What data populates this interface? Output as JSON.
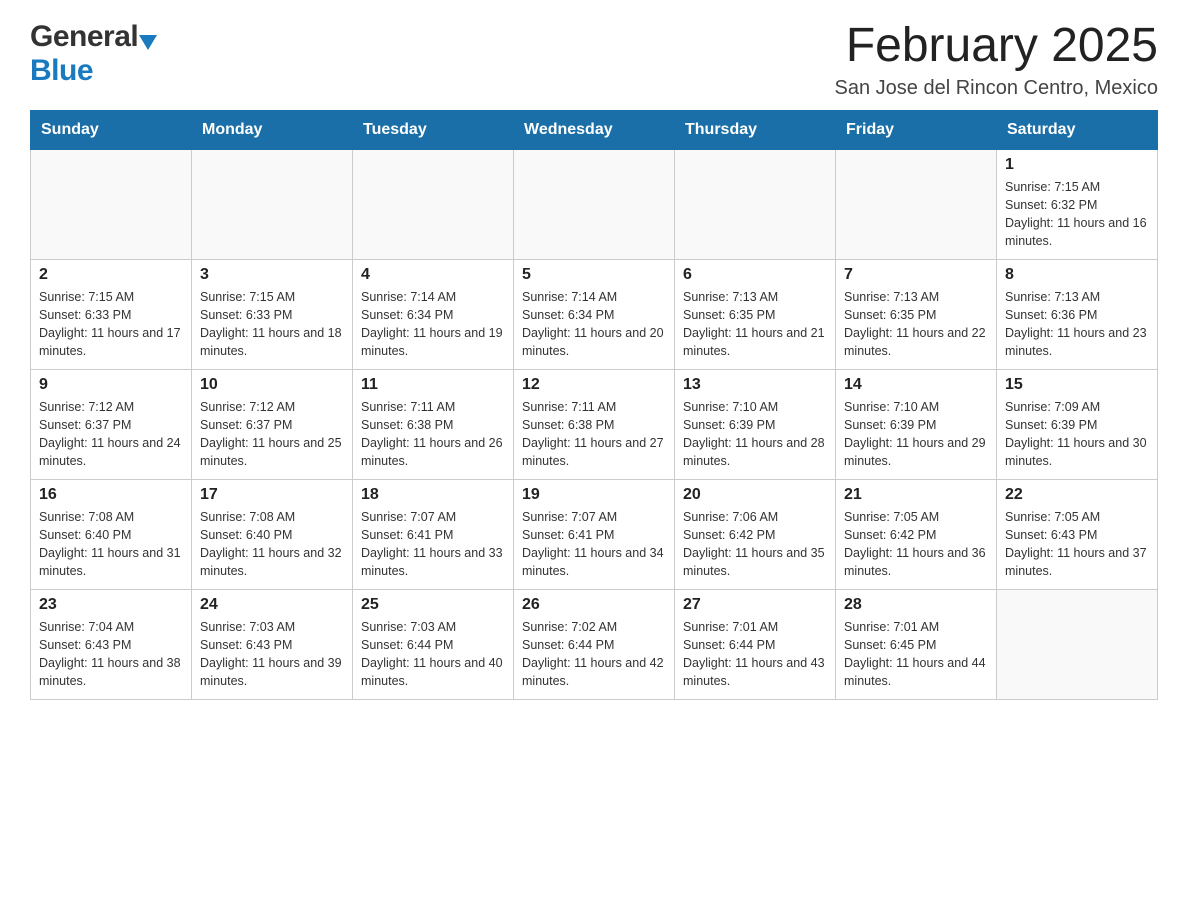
{
  "header": {
    "logo_general": "General",
    "logo_blue": "Blue",
    "title": "February 2025",
    "subtitle": "San Jose del Rincon Centro, Mexico"
  },
  "calendar": {
    "days_of_week": [
      "Sunday",
      "Monday",
      "Tuesday",
      "Wednesday",
      "Thursday",
      "Friday",
      "Saturday"
    ],
    "weeks": [
      [
        {
          "day": "",
          "info": ""
        },
        {
          "day": "",
          "info": ""
        },
        {
          "day": "",
          "info": ""
        },
        {
          "day": "",
          "info": ""
        },
        {
          "day": "",
          "info": ""
        },
        {
          "day": "",
          "info": ""
        },
        {
          "day": "1",
          "info": "Sunrise: 7:15 AM\nSunset: 6:32 PM\nDaylight: 11 hours and 16 minutes."
        }
      ],
      [
        {
          "day": "2",
          "info": "Sunrise: 7:15 AM\nSunset: 6:33 PM\nDaylight: 11 hours and 17 minutes."
        },
        {
          "day": "3",
          "info": "Sunrise: 7:15 AM\nSunset: 6:33 PM\nDaylight: 11 hours and 18 minutes."
        },
        {
          "day": "4",
          "info": "Sunrise: 7:14 AM\nSunset: 6:34 PM\nDaylight: 11 hours and 19 minutes."
        },
        {
          "day": "5",
          "info": "Sunrise: 7:14 AM\nSunset: 6:34 PM\nDaylight: 11 hours and 20 minutes."
        },
        {
          "day": "6",
          "info": "Sunrise: 7:13 AM\nSunset: 6:35 PM\nDaylight: 11 hours and 21 minutes."
        },
        {
          "day": "7",
          "info": "Sunrise: 7:13 AM\nSunset: 6:35 PM\nDaylight: 11 hours and 22 minutes."
        },
        {
          "day": "8",
          "info": "Sunrise: 7:13 AM\nSunset: 6:36 PM\nDaylight: 11 hours and 23 minutes."
        }
      ],
      [
        {
          "day": "9",
          "info": "Sunrise: 7:12 AM\nSunset: 6:37 PM\nDaylight: 11 hours and 24 minutes."
        },
        {
          "day": "10",
          "info": "Sunrise: 7:12 AM\nSunset: 6:37 PM\nDaylight: 11 hours and 25 minutes."
        },
        {
          "day": "11",
          "info": "Sunrise: 7:11 AM\nSunset: 6:38 PM\nDaylight: 11 hours and 26 minutes."
        },
        {
          "day": "12",
          "info": "Sunrise: 7:11 AM\nSunset: 6:38 PM\nDaylight: 11 hours and 27 minutes."
        },
        {
          "day": "13",
          "info": "Sunrise: 7:10 AM\nSunset: 6:39 PM\nDaylight: 11 hours and 28 minutes."
        },
        {
          "day": "14",
          "info": "Sunrise: 7:10 AM\nSunset: 6:39 PM\nDaylight: 11 hours and 29 minutes."
        },
        {
          "day": "15",
          "info": "Sunrise: 7:09 AM\nSunset: 6:39 PM\nDaylight: 11 hours and 30 minutes."
        }
      ],
      [
        {
          "day": "16",
          "info": "Sunrise: 7:08 AM\nSunset: 6:40 PM\nDaylight: 11 hours and 31 minutes."
        },
        {
          "day": "17",
          "info": "Sunrise: 7:08 AM\nSunset: 6:40 PM\nDaylight: 11 hours and 32 minutes."
        },
        {
          "day": "18",
          "info": "Sunrise: 7:07 AM\nSunset: 6:41 PM\nDaylight: 11 hours and 33 minutes."
        },
        {
          "day": "19",
          "info": "Sunrise: 7:07 AM\nSunset: 6:41 PM\nDaylight: 11 hours and 34 minutes."
        },
        {
          "day": "20",
          "info": "Sunrise: 7:06 AM\nSunset: 6:42 PM\nDaylight: 11 hours and 35 minutes."
        },
        {
          "day": "21",
          "info": "Sunrise: 7:05 AM\nSunset: 6:42 PM\nDaylight: 11 hours and 36 minutes."
        },
        {
          "day": "22",
          "info": "Sunrise: 7:05 AM\nSunset: 6:43 PM\nDaylight: 11 hours and 37 minutes."
        }
      ],
      [
        {
          "day": "23",
          "info": "Sunrise: 7:04 AM\nSunset: 6:43 PM\nDaylight: 11 hours and 38 minutes."
        },
        {
          "day": "24",
          "info": "Sunrise: 7:03 AM\nSunset: 6:43 PM\nDaylight: 11 hours and 39 minutes."
        },
        {
          "day": "25",
          "info": "Sunrise: 7:03 AM\nSunset: 6:44 PM\nDaylight: 11 hours and 40 minutes."
        },
        {
          "day": "26",
          "info": "Sunrise: 7:02 AM\nSunset: 6:44 PM\nDaylight: 11 hours and 42 minutes."
        },
        {
          "day": "27",
          "info": "Sunrise: 7:01 AM\nSunset: 6:44 PM\nDaylight: 11 hours and 43 minutes."
        },
        {
          "day": "28",
          "info": "Sunrise: 7:01 AM\nSunset: 6:45 PM\nDaylight: 11 hours and 44 minutes."
        },
        {
          "day": "",
          "info": ""
        }
      ]
    ]
  }
}
